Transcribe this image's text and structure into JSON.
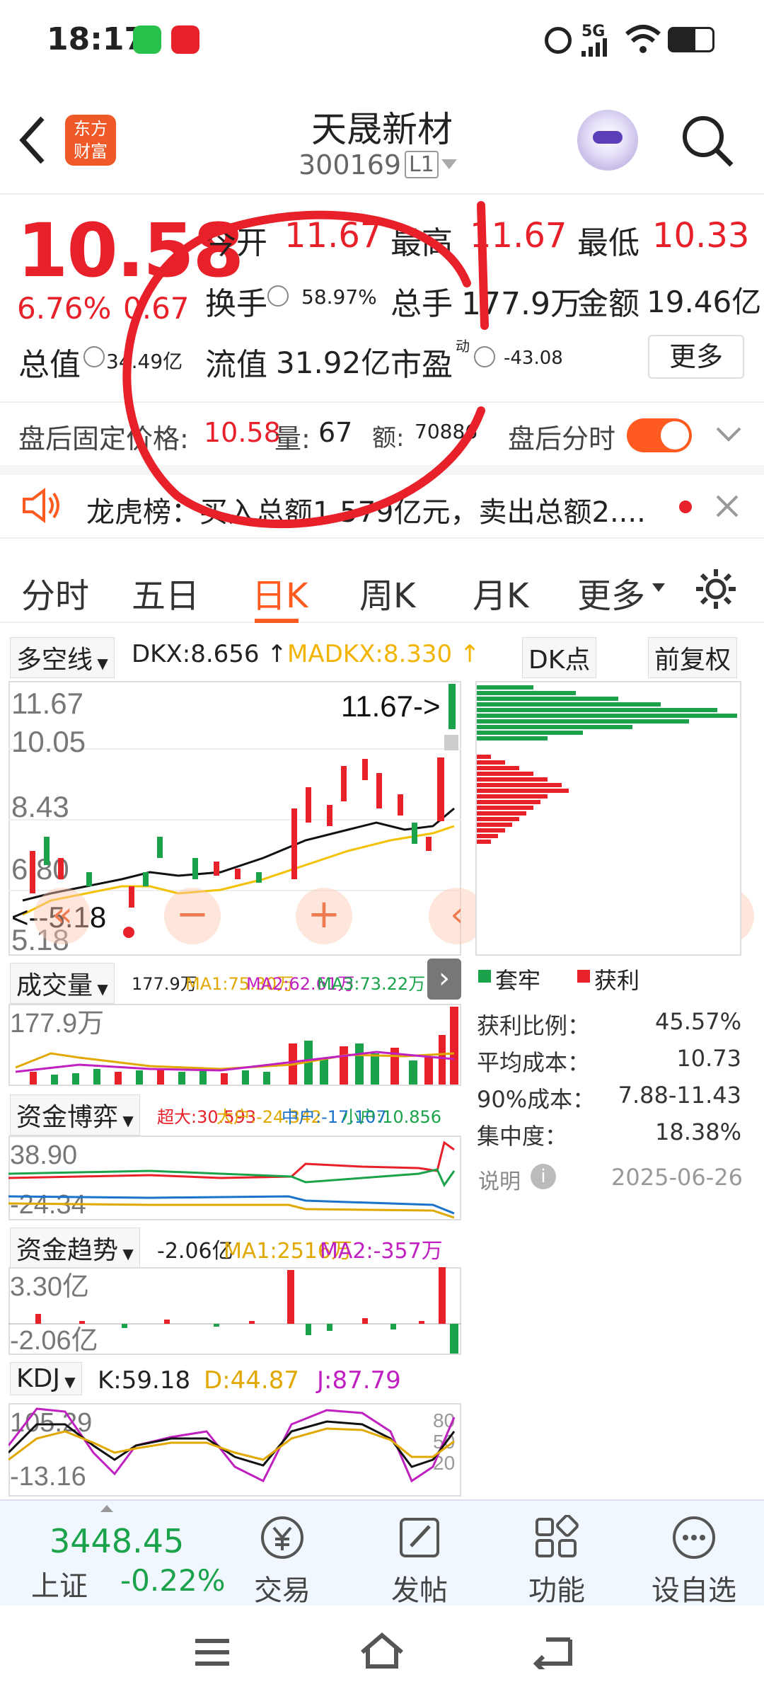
{
  "status_bar": {
    "time": "18:17",
    "network": "5G"
  },
  "header": {
    "title": "天晟新材",
    "code": "300169",
    "level": "L1",
    "logo_text_1": "东方",
    "logo_text_2": "财富"
  },
  "quote": {
    "price": "10.58",
    "change_pct": "6.76%",
    "change": "0.67",
    "open_label": "今开",
    "open": "11.67",
    "high_label": "最高",
    "high": "11.67",
    "low_label": "最低",
    "low": "10.33",
    "turnover_label": "换手",
    "turnover": "58.97%",
    "volume_label": "总手",
    "volume": "177.9万",
    "amount_label": "金额",
    "amount": "19.46亿",
    "mktcap_label": "总值",
    "mktcap": "34.49亿",
    "float_label": "流值",
    "float_cap": "31.92亿",
    "pe_label": "市盈",
    "pe_sup": "动",
    "pe": "-43.08",
    "more_label": "更多"
  },
  "after_hours": {
    "label": "盘后固定价格:",
    "price": "10.58",
    "vol_label": "量:",
    "vol": "67",
    "amt_label": "额:",
    "amt": "70886",
    "toggle_label": "盘后分时"
  },
  "notice": {
    "text": "龙虎榜：买入总额1.579亿元，卖出总额2...."
  },
  "tabs": [
    "分时",
    "五日",
    "日K",
    "周K",
    "月K",
    "更多"
  ],
  "active_tab": "日K",
  "kline": {
    "indicator": "多空线",
    "dkx": "DKX:8.656 ↑",
    "madkx": "MADKX:8.330 ↑",
    "dk_label": "DK点",
    "adjust_label": "前复权",
    "y_labels": [
      "11.67",
      "10.05",
      "8.43",
      "6.80",
      "5.18"
    ],
    "high_marker": "11.67->",
    "low_marker": "<--5.18"
  },
  "chip": {
    "legend_trapped": "套牢",
    "legend_profit": "获利",
    "stats": [
      {
        "label": "获利比例：",
        "value": "45.57%"
      },
      {
        "label": "平均成本：",
        "value": "10.73"
      },
      {
        "label": "90%成本：",
        "value": "7.88-11.43"
      },
      {
        "label": "集中度：",
        "value": "18.38%"
      }
    ],
    "note_label": "说明",
    "date": "2025-06-26"
  },
  "volume_panel": {
    "label": "成交量",
    "v": "177.9万",
    "ma1": "MA1:75.30万",
    "ma2": "MA2:62.61万",
    "ma3": "MA3:73.22万",
    "y_top": "177.9万"
  },
  "fund_game": {
    "label": "资金博弈",
    "super": "超大:30.593",
    "big": "大户:-24.342",
    "mid": "中户:-17.107",
    "small": "小户:10.856",
    "y_top": "38.90",
    "y_bottom": "-24.34"
  },
  "fund_trend": {
    "label": "资金趋势",
    "v": "-2.06亿",
    "ma1": "MA1:2516万",
    "ma2": "MA2:-357万",
    "y_top": "3.30亿",
    "y_bottom": "-2.06亿"
  },
  "kdj": {
    "label": "KDJ",
    "k": "K:59.18",
    "d": "D:44.87",
    "j": "J:87.79",
    "y_top": "105.29",
    "y_bottom": "-13.16",
    "r1": "80",
    "r2": "50",
    "r3": "20"
  },
  "bottom_bar": {
    "index_value": "3448.45",
    "index_name": "上证",
    "index_change": "-0.22%",
    "items": [
      {
        "label": "交易",
        "icon": "yen-icon"
      },
      {
        "label": "发帖",
        "icon": "edit-icon"
      },
      {
        "label": "功能",
        "icon": "grid-icon"
      },
      {
        "label": "设自选",
        "icon": "more-icon"
      }
    ]
  },
  "colors": {
    "up": "#e8202a",
    "down": "#1aa34a",
    "accent": "#ff5a1f"
  }
}
